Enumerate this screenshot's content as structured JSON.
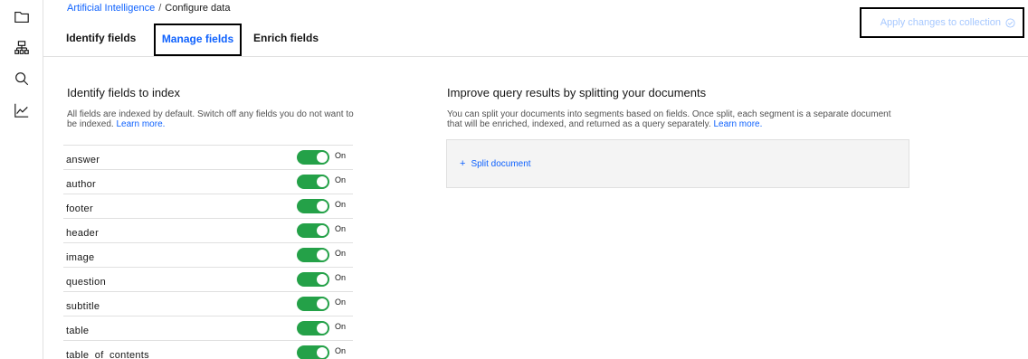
{
  "breadcrumb": {
    "parent": "Artificial Intelligence",
    "separator": "/",
    "current": "Configure data"
  },
  "tabs": [
    {
      "label": "Identify fields"
    },
    {
      "label": "Manage fields",
      "active": true
    },
    {
      "label": "Enrich fields"
    }
  ],
  "apply_button": {
    "label": "Apply changes to collection",
    "icon": "check-circle-icon"
  },
  "rail_icons": [
    "folder-icon",
    "hierarchy-icon",
    "search-icon",
    "chart-line-icon"
  ],
  "index_panel": {
    "title": "Identify fields to index",
    "description": "All fields are indexed by default. Switch off any fields you do not want to be indexed.",
    "learn_more": "Learn more.",
    "fields": [
      {
        "name": "answer",
        "state": "On"
      },
      {
        "name": "author",
        "state": "On"
      },
      {
        "name": "footer",
        "state": "On"
      },
      {
        "name": "header",
        "state": "On"
      },
      {
        "name": "image",
        "state": "On"
      },
      {
        "name": "question",
        "state": "On"
      },
      {
        "name": "subtitle",
        "state": "On"
      },
      {
        "name": "table",
        "state": "On"
      },
      {
        "name": "table_of_contents",
        "state": "On"
      }
    ]
  },
  "split_panel": {
    "title": "Improve query results by splitting your documents",
    "description": "You can split your documents into segments based on fields. Once split, each segment is a separate document that will be enriched, indexed, and returned as a query separately.",
    "learn_more": "Learn more.",
    "split_button": "Split document"
  },
  "colors": {
    "accent": "#0f62fe",
    "toggle_on": "#24a148",
    "apply_disabled": "#a6c8ff"
  }
}
